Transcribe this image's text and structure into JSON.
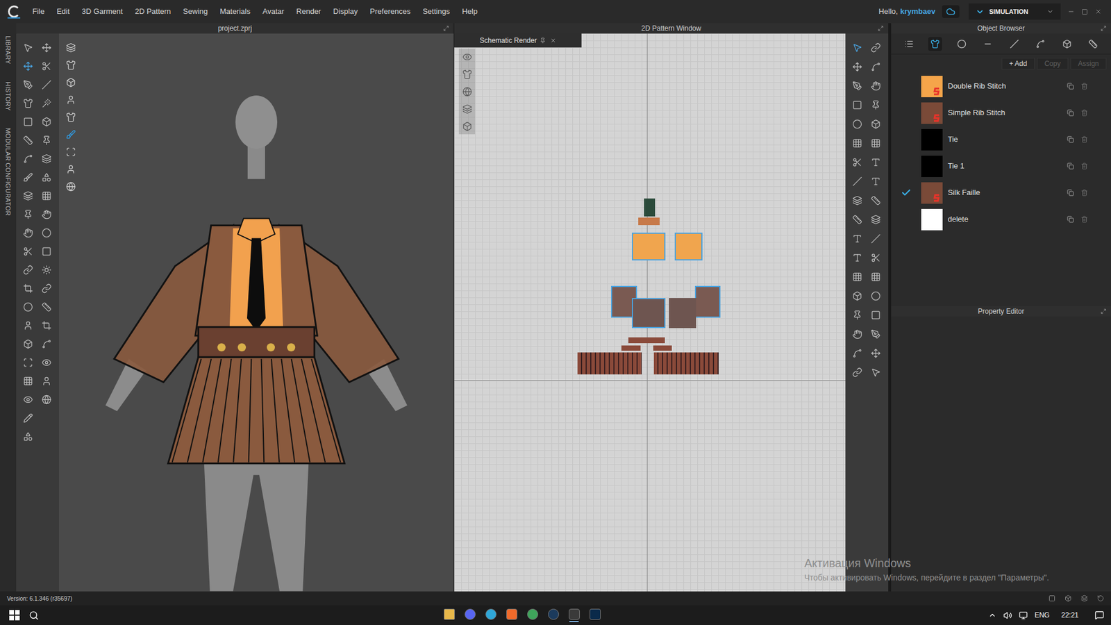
{
  "app": {
    "menu": [
      "File",
      "Edit",
      "3D Garment",
      "2D Pattern",
      "Sewing",
      "Materials",
      "Avatar",
      "Render",
      "Display",
      "Preferences",
      "Settings",
      "Help"
    ],
    "greeting": "Hello,",
    "user": "krymbaev",
    "mode": "SIMULATION"
  },
  "side_tabs": [
    "LIBRARY",
    "HISTORY",
    "MODULAR CONFIGURATOR"
  ],
  "viewport_3d": {
    "title": "project.zprj"
  },
  "pattern_window": {
    "title": "2D Pattern Window",
    "tab": "Schematic Render"
  },
  "object_browser": {
    "title": "Object Browser",
    "tabs": [
      {
        "selected": false
      },
      {
        "selected": true
      },
      {
        "selected": false
      },
      {
        "selected": false
      },
      {
        "selected": false
      },
      {
        "selected": false
      },
      {
        "selected": false
      },
      {
        "selected": false
      }
    ],
    "actions": [
      {
        "label": "+ Add",
        "disabled": false
      },
      {
        "label": "Copy",
        "disabled": true
      },
      {
        "label": "Assign",
        "disabled": true
      }
    ],
    "materials": [
      {
        "name": "Double Rib Stitch",
        "color": "#f5a54a",
        "kind": "substance",
        "selected": false
      },
      {
        "name": "Simple Rib Stitch",
        "color": "#7a4a38",
        "kind": "substance",
        "selected": false
      },
      {
        "name": "Tie",
        "color": "#000000",
        "kind": "plain",
        "selected": false
      },
      {
        "name": "Tie 1",
        "color": "#000000",
        "kind": "plain",
        "selected": false
      },
      {
        "name": "Silk Faille",
        "color": "#7a4a38",
        "kind": "substance",
        "selected": true
      },
      {
        "name": "delete",
        "color": "#ffffff",
        "kind": "plain",
        "selected": false
      }
    ]
  },
  "property_editor": {
    "title": "Property Editor"
  },
  "status_bar": {
    "version": "Version: 6.1.346 (r35697)"
  },
  "watermark": {
    "title": "Активация Windows",
    "text": "Чтобы активировать Windows, перейдите в раздел \"Параметры\"."
  },
  "taskbar": {
    "language": "ENG",
    "time": "22:21"
  }
}
